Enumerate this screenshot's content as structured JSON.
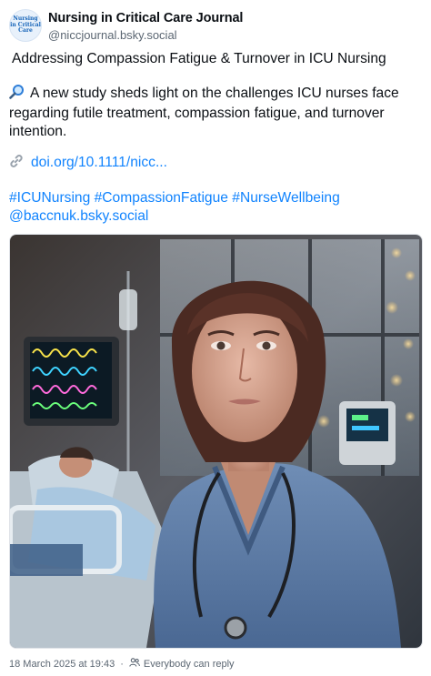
{
  "author": {
    "display_name": "Nursing in Critical Care Journal",
    "handle": "@niccjournal.bsky.social",
    "avatar_text": [
      "Nursing",
      "in Critical",
      "Care"
    ]
  },
  "post": {
    "title": "Addressing Compassion Fatigue & Turnover in ICU Nursing",
    "paragraph": "A new study sheds light on the challenges ICU nurses face regarding futile treatment, compassion fatigue, and turnover intention.",
    "link": "doi.org/10.1111/nicc...",
    "hashtags": "#ICUNursing #CompassionFatigue #NurseWellbeing",
    "mention": "@baccnuk.bsky.social",
    "icons": {
      "magnifier": "magnifying-glass-icon",
      "link": "link-chain-icon"
    }
  },
  "media": {
    "alt": "Illustration of an ICU nurse in blue scrubs with a stethoscope; a patient lies in a hospital bed beside monitors."
  },
  "footer": {
    "timestamp": "18 March 2025 at 19:43",
    "reply_setting": "Everybody can reply"
  },
  "colors": {
    "link": "#1083fe",
    "text": "#0b0f14",
    "muted": "#5b6672"
  }
}
